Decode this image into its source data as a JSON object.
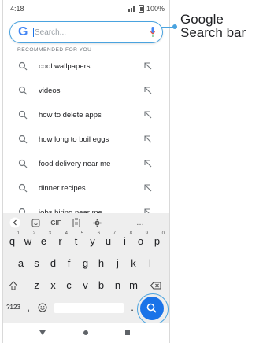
{
  "status_bar": {
    "time": "4:18",
    "battery": "100%"
  },
  "search": {
    "logo": "G",
    "placeholder": "Search..."
  },
  "recommended": {
    "title": "RECOMMENDED FOR YOU",
    "items": [
      "cool wallpapers",
      "videos",
      "how to delete apps",
      "how long to boil eggs",
      "food delivery near me",
      "dinner recipes",
      "jobs hiring near me"
    ]
  },
  "keyboard": {
    "toolbar": [
      "GIF",
      "…"
    ],
    "row1": [
      {
        "k": "q",
        "n": "1"
      },
      {
        "k": "w",
        "n": "2"
      },
      {
        "k": "e",
        "n": "3"
      },
      {
        "k": "r",
        "n": "4"
      },
      {
        "k": "t",
        "n": "5"
      },
      {
        "k": "y",
        "n": "6"
      },
      {
        "k": "u",
        "n": "7"
      },
      {
        "k": "i",
        "n": "8"
      },
      {
        "k": "o",
        "n": "9"
      },
      {
        "k": "p",
        "n": "0"
      }
    ],
    "row2": [
      "a",
      "s",
      "d",
      "f",
      "g",
      "h",
      "j",
      "k",
      "l"
    ],
    "row3": [
      "z",
      "x",
      "c",
      "v",
      "b",
      "n",
      "m"
    ],
    "sym": "?123",
    "comma": ",",
    "period": "."
  },
  "callout": {
    "line1": "Google",
    "line2": "Search bar"
  },
  "colors": {
    "accent": "#1a73e8",
    "callout": "#4aa3df"
  },
  "icons": [
    "signal-icon",
    "battery-icon",
    "google-logo-icon",
    "mic-icon",
    "search-icon",
    "arrow-up-left-icon",
    "chevron-left-icon",
    "sticker-icon",
    "clipboard-icon",
    "gear-icon",
    "shift-icon",
    "backspace-icon",
    "emoji-icon",
    "back-icon",
    "home-icon",
    "recent-apps-icon"
  ]
}
